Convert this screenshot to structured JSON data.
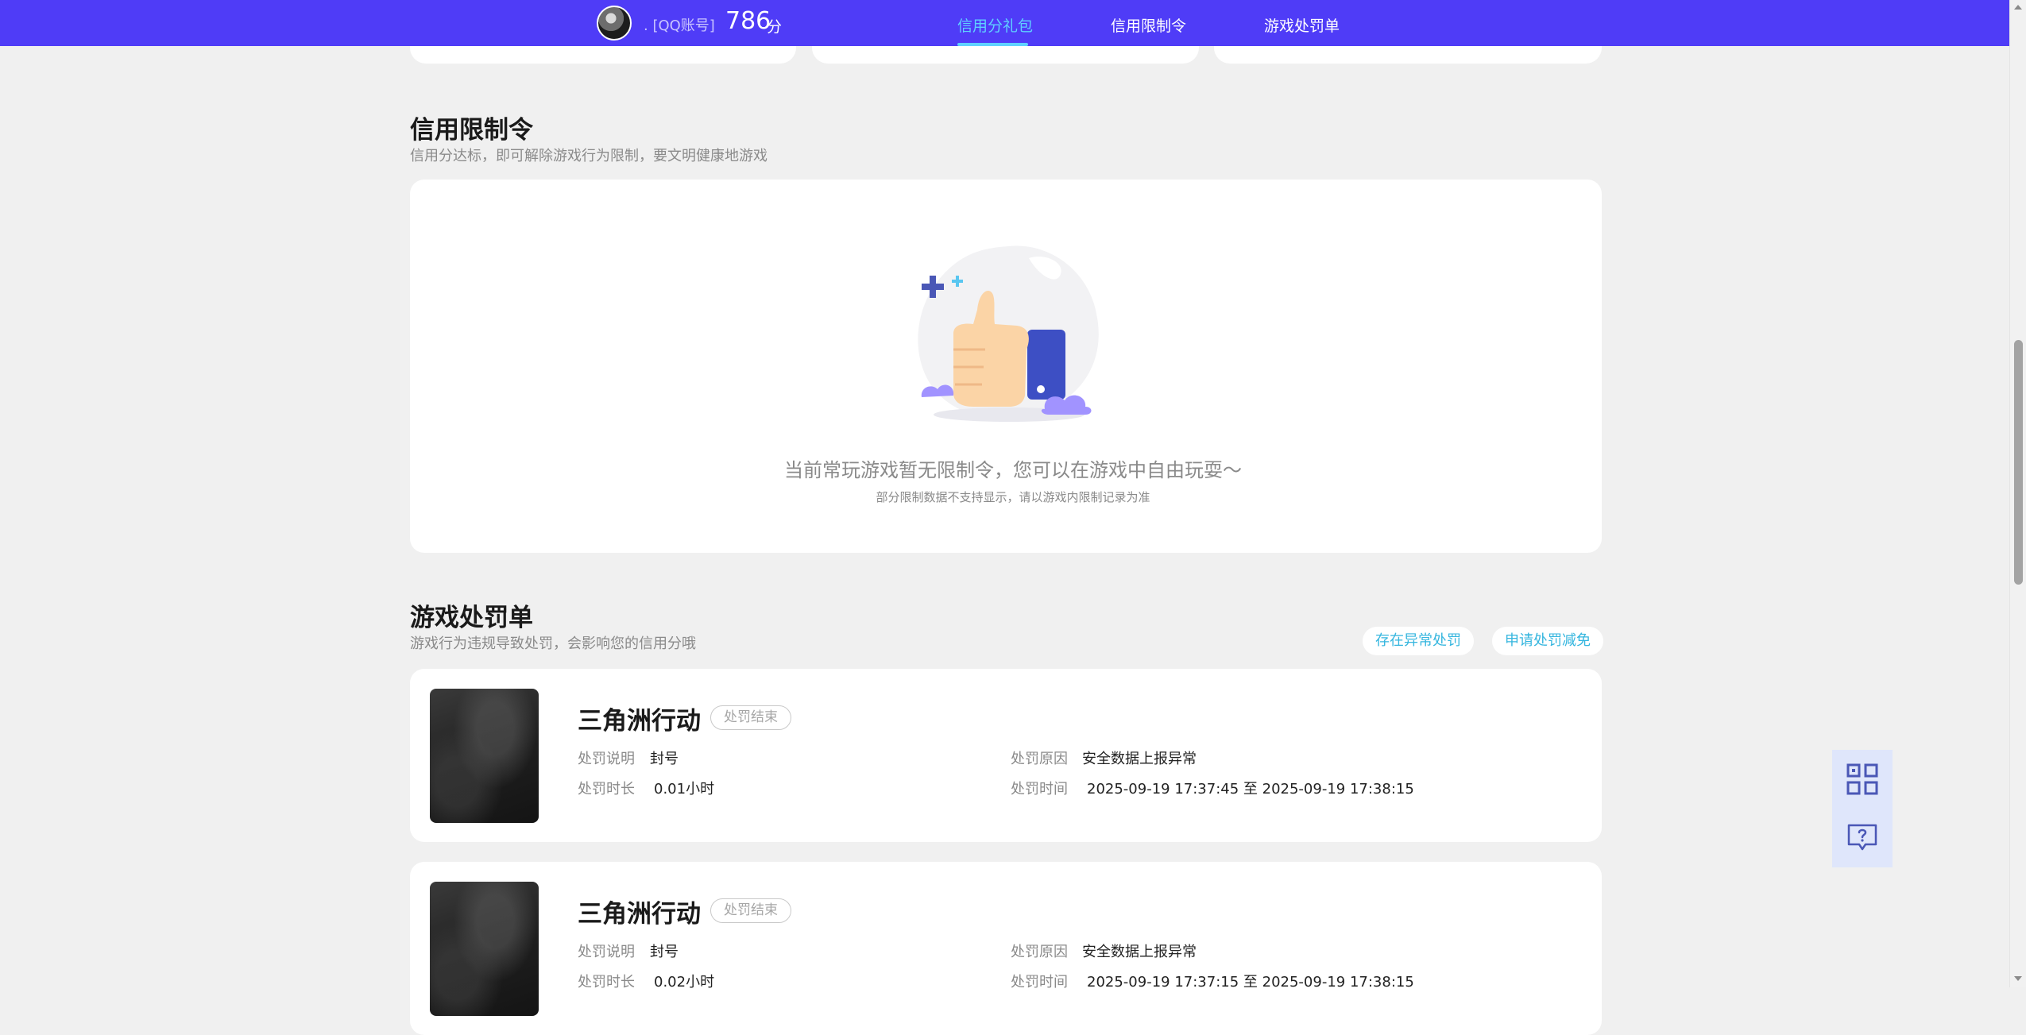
{
  "header": {
    "account_label": ". [QQ账号]",
    "score": "786",
    "score_unit": "分",
    "nav": [
      {
        "label": "信用分礼包",
        "active": true
      },
      {
        "label": "信用限制令",
        "active": false
      },
      {
        "label": "游戏处罚单",
        "active": false
      }
    ],
    "accent_color": "#4f3cf7"
  },
  "restriction": {
    "title": "信用限制令",
    "subtitle": "信用分达标，即可解除游戏行为限制，要文明健康地游戏",
    "empty_message": "当前常玩游戏暂无限制令，您可以在游戏中自由玩耍～",
    "empty_note": "部分限制数据不支持显示，请以游戏内限制记录为准",
    "illustration": "thumbs-up-illustration"
  },
  "penalties": {
    "title": "游戏处罚单",
    "subtitle": "游戏行为违规导致处罚，会影响您的信用分哦",
    "abnormal_button": "存在异常处罚",
    "appeal_button": "申请处罚减免",
    "field_labels": {
      "desc": "处罚说明",
      "duration": "处罚时长",
      "reason": "处罚原因",
      "time": "处罚时间"
    },
    "records": [
      {
        "game": "三角洲行动",
        "status": "处罚结束",
        "desc": "封号",
        "duration": "0.01小时",
        "reason": "安全数据上报异常",
        "time": "2025-09-19 17:37:45 至 2025-09-19 17:38:15"
      },
      {
        "game": "三角洲行动",
        "status": "处罚结束",
        "desc": "封号",
        "duration": "0.02小时",
        "reason": "安全数据上报异常",
        "time": "2025-09-19 17:37:15 至 2025-09-19 17:38:15"
      }
    ]
  },
  "floating": {
    "qr_icon": "qr-code-icon",
    "help_icon": "help-chat-icon"
  }
}
